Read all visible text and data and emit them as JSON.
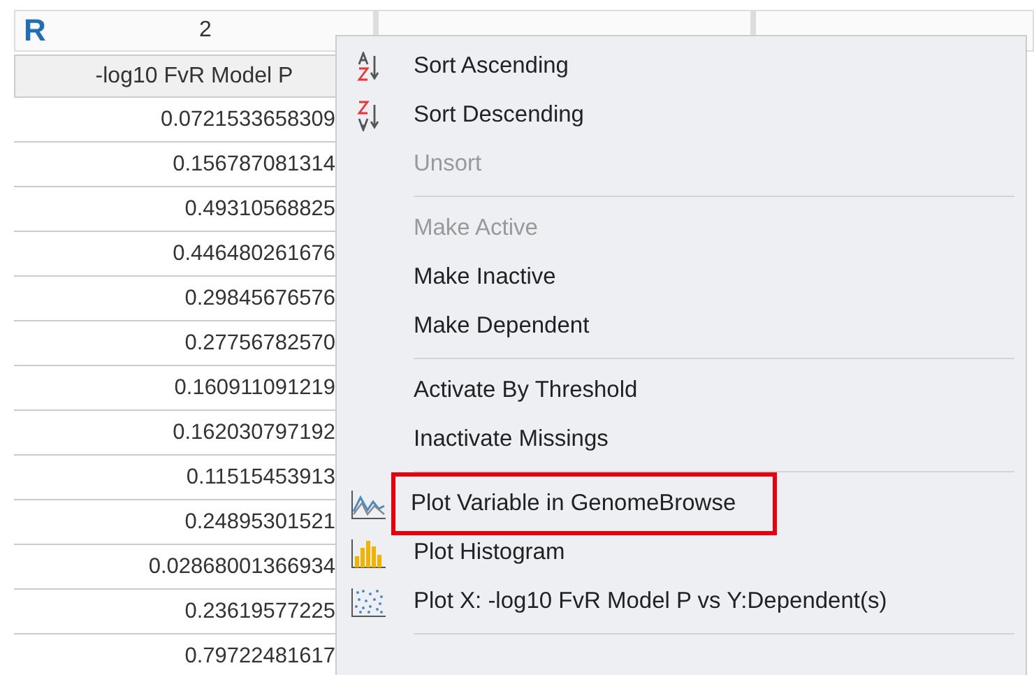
{
  "table": {
    "columns": [
      {
        "type_letter": "R",
        "number": "2",
        "name": "-log10 FvR Model P"
      }
    ],
    "rows": [
      "0.0721533658309",
      "0.156787081314",
      "0.49310568825",
      "0.446480261676",
      "0.29845676576",
      "0.27756782570",
      "0.160911091219",
      "0.162030797192",
      "0.11515453913",
      "0.24895301521",
      "0.02868001366934",
      "0.23619577225",
      "0.79722481617"
    ]
  },
  "context_menu": {
    "items": [
      {
        "kind": "sortup",
        "label": "Sort Ascending",
        "disabled": false,
        "highlighted": false
      },
      {
        "kind": "sortdown",
        "label": "Sort Descending",
        "disabled": false,
        "highlighted": false
      },
      {
        "kind": "plain",
        "label": "Unsort",
        "disabled": true,
        "highlighted": false
      },
      {
        "kind": "separator"
      },
      {
        "kind": "plain",
        "label": "Make Active",
        "disabled": true,
        "highlighted": false
      },
      {
        "kind": "plain",
        "label": "Make Inactive",
        "disabled": false,
        "highlighted": false
      },
      {
        "kind": "plain",
        "label": "Make Dependent",
        "disabled": false,
        "highlighted": false
      },
      {
        "kind": "separator"
      },
      {
        "kind": "plain",
        "label": "Activate By Threshold",
        "disabled": false,
        "highlighted": false
      },
      {
        "kind": "plain",
        "label": "Inactivate Missings",
        "disabled": false,
        "highlighted": false
      },
      {
        "kind": "separator"
      },
      {
        "kind": "lineplot",
        "label": "Plot Variable in GenomeBrowse",
        "disabled": false,
        "highlighted": true
      },
      {
        "kind": "histogram",
        "label": "Plot Histogram",
        "disabled": false,
        "highlighted": false
      },
      {
        "kind": "scatter",
        "label": "Plot X: -log10 FvR Model P vs Y:Dependent(s)",
        "disabled": false,
        "highlighted": false
      },
      {
        "kind": "separator"
      }
    ]
  }
}
